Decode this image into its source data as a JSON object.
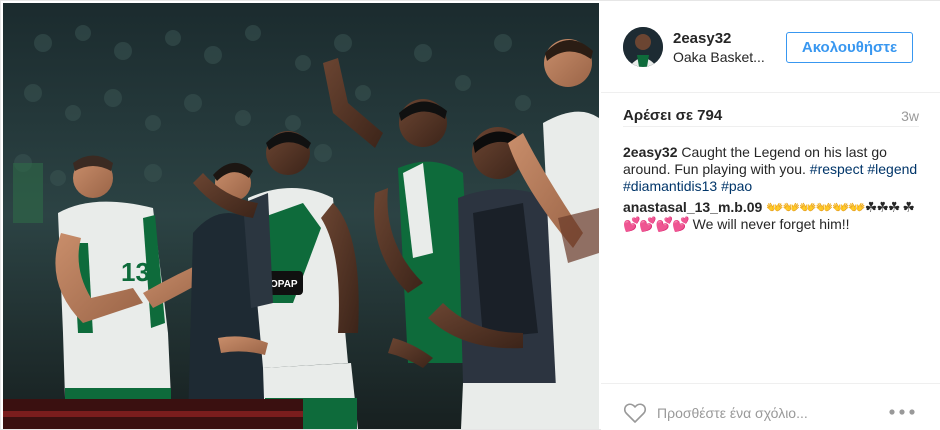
{
  "post": {
    "author": {
      "username": "2easy32",
      "location": "Oaka Basket..."
    },
    "follow_label": "Ακολουθήστε",
    "likes": "Αρέσει σε 794",
    "time": "3w",
    "caption": {
      "username": "2easy32",
      "text": "Caught the Legend on his last go around. Fun playing with you.",
      "tags": [
        "#respect",
        "#legend",
        "#diamantidis13",
        "#pao"
      ]
    },
    "comments": [
      {
        "username": "anastasal_13_m.b.09",
        "emojis": "👐👐👐👐👐👐☘☘☘ ☘💕💕💕💕",
        "text": "We will never forget him!!"
      }
    ],
    "add_comment_placeholder": "Προσθέστε ένα σχόλιο...",
    "icons": {
      "like": "heart-icon",
      "more": "more-options-icon"
    },
    "photo": {
      "jersey_numbers": [
        "13"
      ],
      "jersey_sponsor": "OPAP"
    },
    "colors": {
      "accent": "#3897f0",
      "hashtag": "#003569",
      "muted": "#999999",
      "team_green": "#0e6b3b"
    }
  }
}
